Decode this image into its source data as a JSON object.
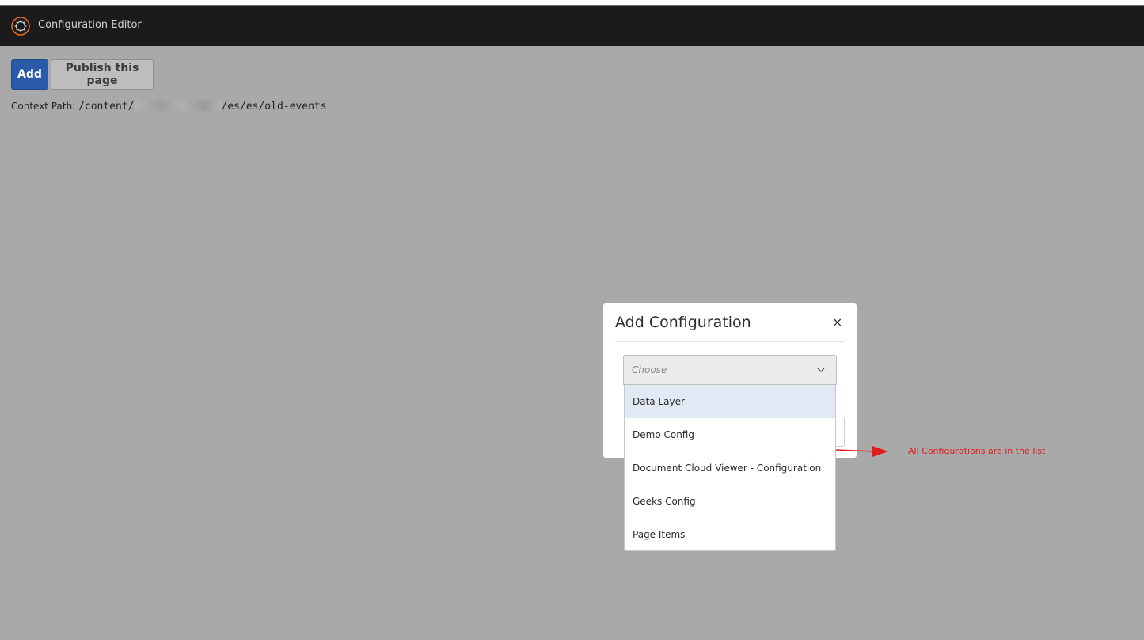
{
  "app": {
    "title": "Configuration Editor",
    "icon": "adobe-experience-manager-icon"
  },
  "toolbar": {
    "add_label": "Add",
    "publish_label": "Publish this page"
  },
  "context": {
    "label": "Context Path:",
    "path_start": "/content/",
    "path_end": "/es/es/old-events"
  },
  "modal": {
    "title": "Add Configuration",
    "close_symbol": "×",
    "select": {
      "placeholder": "Choose",
      "options": [
        "Data Layer",
        "Demo Config",
        "Document Cloud Viewer - Configuration",
        "Geeks Config",
        "Page Items"
      ],
      "highlighted_index": 0
    }
  },
  "annotation": {
    "text": "All Configurations are in the list",
    "color": "#e01b1b"
  },
  "colors": {
    "primary": "#2a5ba8",
    "appbar": "#1b1b1b",
    "overlay": "#a9a9a9"
  }
}
